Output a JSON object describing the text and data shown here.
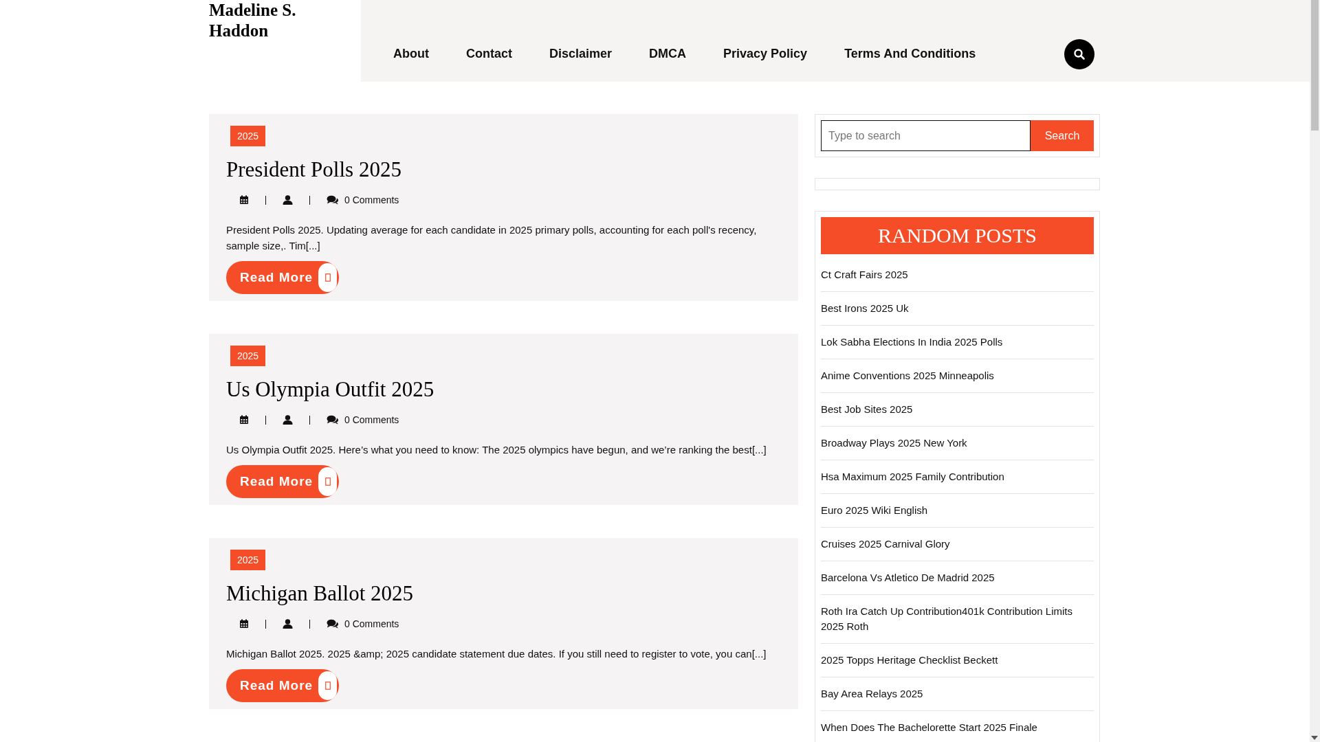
{
  "site_title": "Madeline S. Haddon",
  "nav": {
    "items": [
      "About",
      "Contact",
      "Disclaimer",
      "DMCA",
      "Privacy Policy",
      "Terms And Conditions"
    ]
  },
  "posts": [
    {
      "category": "2025",
      "title": "President Polls 2025",
      "comments": "0 Comments",
      "excerpt": "President Polls 2025. Updating average for each candidate in 2025 primary polls, accounting for each poll's recency, sample size,. Tim[...]",
      "button": "Read More"
    },
    {
      "category": "2025",
      "title": "Us Olympia Outfit 2025",
      "comments": "0 Comments",
      "excerpt": "Us Olympia Outfit 2025. Here’s what you need to know: The 2025 olympics have begun, and we’re ranking the best[...]",
      "button": "Read More"
    },
    {
      "category": "2025",
      "title": "Michigan Ballot 2025",
      "comments": "0 Comments",
      "excerpt": "Michigan Ballot 2025. 2025 &amp; 2025 candidate statement due dates. If you still need to register to vote, you can[...]",
      "button": "Read More"
    }
  ],
  "sidebar": {
    "search": {
      "placeholder": "Type to search",
      "button": "Search"
    },
    "random_posts": {
      "title": "RANDOM POSTS",
      "items": [
        "Ct Craft Fairs 2025",
        "Best Irons 2025 Uk",
        "Lok Sabha Elections In India 2025 Polls",
        "Anime Conventions 2025 Minneapolis",
        "Best Job Sites 2025",
        "Broadway Plays 2025 New York",
        "Hsa Maximum 2025 Family Contribution",
        "Euro 2025 Wiki English",
        "Cruises 2025 Carnival Glory",
        "Barcelona Vs Atletico De Madrid 2025",
        "Roth Ira Catch Up Contribution401k Contribution Limits 2025 Roth",
        "2025 Topps Heritage Checklist Beckett",
        "Bay Area Relays 2025",
        "When Does The Bachelorette Start 2025 Finale"
      ]
    }
  }
}
